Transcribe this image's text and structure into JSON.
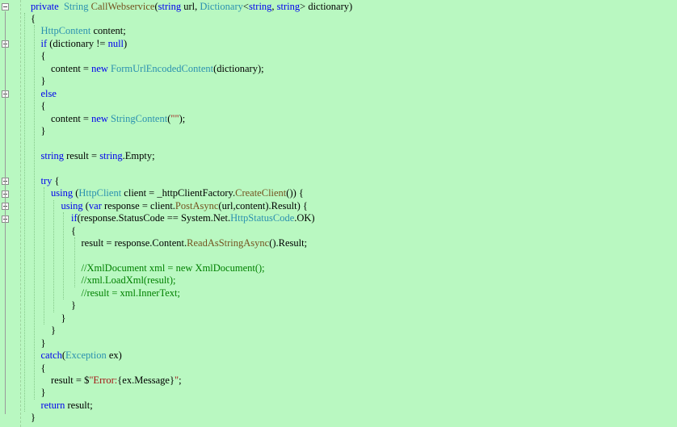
{
  "editor": {
    "lines": [
      {
        "indent": 0,
        "tokens": [
          {
            "t": "private",
            "c": "kw"
          },
          {
            "t": "  ",
            "c": "pl"
          },
          {
            "t": "String",
            "c": "type"
          },
          {
            "t": " ",
            "c": "pl"
          },
          {
            "t": "CallWebservice",
            "c": "fn"
          },
          {
            "t": "(",
            "c": "pl"
          },
          {
            "t": "string",
            "c": "kw"
          },
          {
            "t": " url, ",
            "c": "pl"
          },
          {
            "t": "Dictionary",
            "c": "type"
          },
          {
            "t": "<",
            "c": "pl"
          },
          {
            "t": "string",
            "c": "kw"
          },
          {
            "t": ", ",
            "c": "pl"
          },
          {
            "t": "string",
            "c": "kw"
          },
          {
            "t": "> dictionary)",
            "c": "pl"
          }
        ]
      },
      {
        "indent": 0,
        "tokens": [
          {
            "t": "{",
            "c": "pl"
          }
        ]
      },
      {
        "indent": 1,
        "tokens": [
          {
            "t": "HttpContent",
            "c": "type"
          },
          {
            "t": " content;",
            "c": "pl"
          }
        ]
      },
      {
        "indent": 1,
        "tokens": [
          {
            "t": "if",
            "c": "kw"
          },
          {
            "t": " (dictionary != ",
            "c": "pl"
          },
          {
            "t": "null",
            "c": "kw"
          },
          {
            "t": ")",
            "c": "pl"
          }
        ]
      },
      {
        "indent": 1,
        "tokens": [
          {
            "t": "{",
            "c": "pl"
          }
        ]
      },
      {
        "indent": 2,
        "tokens": [
          {
            "t": "content = ",
            "c": "pl"
          },
          {
            "t": "new",
            "c": "kw"
          },
          {
            "t": " ",
            "c": "pl"
          },
          {
            "t": "FormUrlEncodedContent",
            "c": "type"
          },
          {
            "t": "(dictionary);",
            "c": "pl"
          }
        ]
      },
      {
        "indent": 1,
        "tokens": [
          {
            "t": "}",
            "c": "pl"
          }
        ]
      },
      {
        "indent": 1,
        "tokens": [
          {
            "t": "else",
            "c": "kw"
          }
        ]
      },
      {
        "indent": 1,
        "tokens": [
          {
            "t": "{",
            "c": "pl"
          }
        ]
      },
      {
        "indent": 2,
        "tokens": [
          {
            "t": "content = ",
            "c": "pl"
          },
          {
            "t": "new",
            "c": "kw"
          },
          {
            "t": " ",
            "c": "pl"
          },
          {
            "t": "StringContent",
            "c": "type"
          },
          {
            "t": "(",
            "c": "pl"
          },
          {
            "t": "\"\"",
            "c": "str"
          },
          {
            "t": ");",
            "c": "pl"
          }
        ]
      },
      {
        "indent": 1,
        "tokens": [
          {
            "t": "}",
            "c": "pl"
          }
        ]
      },
      {
        "indent": 0,
        "tokens": []
      },
      {
        "indent": 1,
        "tokens": [
          {
            "t": "string",
            "c": "kw"
          },
          {
            "t": " result = ",
            "c": "pl"
          },
          {
            "t": "string",
            "c": "kw"
          },
          {
            "t": ".Empty;",
            "c": "pl"
          }
        ]
      },
      {
        "indent": 0,
        "tokens": []
      },
      {
        "indent": 1,
        "tokens": [
          {
            "t": "try",
            "c": "kw"
          },
          {
            "t": " {",
            "c": "pl"
          }
        ]
      },
      {
        "indent": 2,
        "tokens": [
          {
            "t": "using",
            "c": "kw"
          },
          {
            "t": " (",
            "c": "pl"
          },
          {
            "t": "HttpClient",
            "c": "type"
          },
          {
            "t": " client = _httpClientFactory.",
            "c": "pl"
          },
          {
            "t": "CreateClient",
            "c": "fn"
          },
          {
            "t": "()) {",
            "c": "pl"
          }
        ]
      },
      {
        "indent": 3,
        "tokens": [
          {
            "t": "using",
            "c": "kw"
          },
          {
            "t": " (",
            "c": "pl"
          },
          {
            "t": "var",
            "c": "kw"
          },
          {
            "t": " response = client.",
            "c": "pl"
          },
          {
            "t": "PostAsync",
            "c": "fn"
          },
          {
            "t": "(url,content).Result) {",
            "c": "pl"
          }
        ]
      },
      {
        "indent": 4,
        "tokens": [
          {
            "t": "if",
            "c": "kw"
          },
          {
            "t": "(response.StatusCode == System.Net.",
            "c": "pl"
          },
          {
            "t": "HttpStatusCode",
            "c": "type"
          },
          {
            "t": ".OK)",
            "c": "pl"
          }
        ]
      },
      {
        "indent": 4,
        "tokens": [
          {
            "t": "{",
            "c": "pl"
          }
        ]
      },
      {
        "indent": 5,
        "tokens": [
          {
            "t": "result = response.Content.",
            "c": "pl"
          },
          {
            "t": "ReadAsStringAsync",
            "c": "fn"
          },
          {
            "t": "().Result;",
            "c": "pl"
          }
        ]
      },
      {
        "indent": 0,
        "tokens": []
      },
      {
        "indent": 5,
        "tokens": [
          {
            "t": "//XmlDocument xml = new XmlDocument();",
            "c": "cmt"
          }
        ]
      },
      {
        "indent": 5,
        "tokens": [
          {
            "t": "//xml.LoadXml(result);",
            "c": "cmt"
          }
        ]
      },
      {
        "indent": 5,
        "tokens": [
          {
            "t": "//result = xml.InnerText;",
            "c": "cmt"
          }
        ]
      },
      {
        "indent": 4,
        "tokens": [
          {
            "t": "}",
            "c": "pl"
          }
        ]
      },
      {
        "indent": 3,
        "tokens": [
          {
            "t": "}",
            "c": "pl"
          }
        ]
      },
      {
        "indent": 2,
        "tokens": [
          {
            "t": "}",
            "c": "pl"
          }
        ]
      },
      {
        "indent": 1,
        "tokens": [
          {
            "t": "}",
            "c": "pl"
          }
        ]
      },
      {
        "indent": 1,
        "tokens": [
          {
            "t": "catch",
            "c": "kw"
          },
          {
            "t": "(",
            "c": "pl"
          },
          {
            "t": "Exception",
            "c": "type"
          },
          {
            "t": " ex)",
            "c": "pl"
          }
        ]
      },
      {
        "indent": 1,
        "tokens": [
          {
            "t": "{",
            "c": "pl"
          }
        ]
      },
      {
        "indent": 2,
        "tokens": [
          {
            "t": "result = $",
            "c": "pl"
          },
          {
            "t": "\"Error:",
            "c": "str"
          },
          {
            "t": "{ex.Message}",
            "c": "pl"
          },
          {
            "t": "\"",
            "c": "str"
          },
          {
            "t": ";",
            "c": "pl"
          }
        ]
      },
      {
        "indent": 1,
        "tokens": [
          {
            "t": "}",
            "c": "pl"
          }
        ]
      },
      {
        "indent": 1,
        "tokens": [
          {
            "t": "return",
            "c": "kw"
          },
          {
            "t": " result;",
            "c": "pl"
          }
        ]
      },
      {
        "indent": 0,
        "tokens": [
          {
            "t": "}",
            "c": "pl"
          }
        ]
      }
    ]
  },
  "theme": {
    "background": "#b9f8c1",
    "keyword": "#0000ee",
    "type": "#2b91af",
    "method": "#74531f",
    "comment": "#008000",
    "string": "#a31515"
  }
}
